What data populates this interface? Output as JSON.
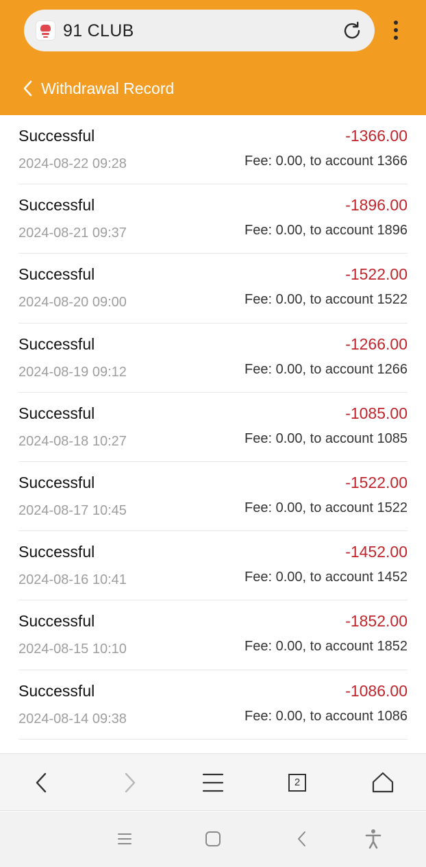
{
  "browser": {
    "site_title": "91 CLUB",
    "favicon": "91-club-logo",
    "reload_icon": "reload-icon",
    "menu_icon": "more-vertical-icon",
    "accent_color": "#F39C22"
  },
  "page": {
    "title": "Withdrawal Record",
    "back_icon": "chevron-left-icon"
  },
  "records": [
    {
      "status": "Successful",
      "amount": "-1366.00",
      "date": "2024-08-22 09:28",
      "fee": "Fee: 0.00, to account 1366"
    },
    {
      "status": "Successful",
      "amount": "-1896.00",
      "date": "2024-08-21 09:37",
      "fee": "Fee: 0.00, to account 1896"
    },
    {
      "status": "Successful",
      "amount": "-1522.00",
      "date": "2024-08-20 09:00",
      "fee": "Fee: 0.00, to account 1522"
    },
    {
      "status": "Successful",
      "amount": "-1266.00",
      "date": "2024-08-19 09:12",
      "fee": "Fee: 0.00, to account 1266"
    },
    {
      "status": "Successful",
      "amount": "-1085.00",
      "date": "2024-08-18 10:27",
      "fee": "Fee: 0.00, to account 1085"
    },
    {
      "status": "Successful",
      "amount": "-1522.00",
      "date": "2024-08-17 10:45",
      "fee": "Fee: 0.00, to account 1522"
    },
    {
      "status": "Successful",
      "amount": "-1452.00",
      "date": "2024-08-16 10:41",
      "fee": "Fee: 0.00, to account 1452"
    },
    {
      "status": "Successful",
      "amount": "-1852.00",
      "date": "2024-08-15 10:10",
      "fee": "Fee: 0.00, to account 1852"
    },
    {
      "status": "Successful",
      "amount": "-1086.00",
      "date": "2024-08-14 09:38",
      "fee": "Fee: 0.00, to account 1086"
    }
  ],
  "browser_toolbar": {
    "tab_count": "2",
    "icons": [
      "back-icon",
      "forward-icon",
      "menu-icon",
      "tabs-icon",
      "home-icon"
    ]
  },
  "system_nav": {
    "icons": [
      "recent-apps-icon",
      "home-icon",
      "back-icon",
      "accessibility-icon"
    ]
  },
  "colors": {
    "amount": "#C0242B",
    "date": "#9E9E9E",
    "divider": "#E6E6E6"
  }
}
